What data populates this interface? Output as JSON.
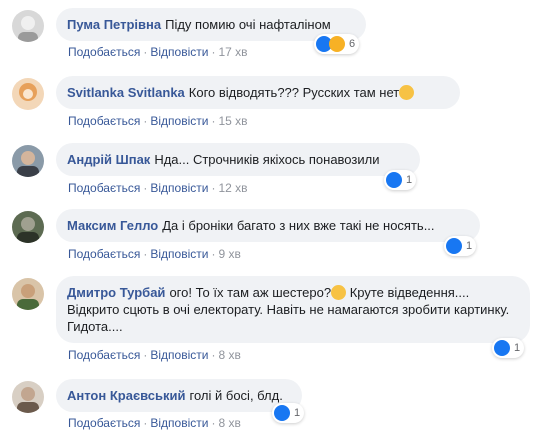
{
  "strings": {
    "like": "Подобається",
    "reply": "Відповісти",
    "dot": "·"
  },
  "colors": {
    "author": "#385898",
    "bubble": "#f0f2f5",
    "like_badge": "#1877f2",
    "haha_badge": "#f7b125"
  },
  "comments": [
    {
      "author": "Пума Петрівна",
      "text": "Піду помию очі нафталіном",
      "time": "17 хв",
      "reactions": [
        "like",
        "haha"
      ],
      "reaction_count": "6",
      "avatar_color": "#c8c8c8"
    },
    {
      "author": "Svitlanka Svitlanka",
      "text": "Кого відводять??? Русских там нет",
      "emoji": "grinning-sweat-emoji",
      "time": "15 хв",
      "reactions": [],
      "reaction_count": "",
      "avatar_color": "#e7a05a"
    },
    {
      "author": "Андрій Шпак",
      "text": "Нда... Строчників якіхось понавозили",
      "time": "12 хв",
      "reactions": [
        "like"
      ],
      "reaction_count": "1",
      "avatar_color": "#6b7a8a"
    },
    {
      "author": "Максим Гелло",
      "text": "Да і броніки багато з них вже такі не носять...",
      "time": "9 хв",
      "reactions": [
        "like"
      ],
      "reaction_count": "1",
      "avatar_color": "#4f5a4a"
    },
    {
      "author": "Дмитро Турбай",
      "text": "ого! То їх там аж шестеро?",
      "emoji": "thinking-emoji",
      "text2": " Круте відведення.... Відкрито сцють в очі електорату. Навіть не намагаются зробити картинку. Гидота....",
      "time": "8 хв",
      "reactions": [
        "like"
      ],
      "reaction_count": "1",
      "avatar_color": "#c9a07a"
    },
    {
      "author": "Антон Краєвський",
      "text": "голі й босі, блд.",
      "time": "8 хв",
      "reactions": [
        "like"
      ],
      "reaction_count": "1",
      "avatar_color": "#b59a88"
    }
  ]
}
